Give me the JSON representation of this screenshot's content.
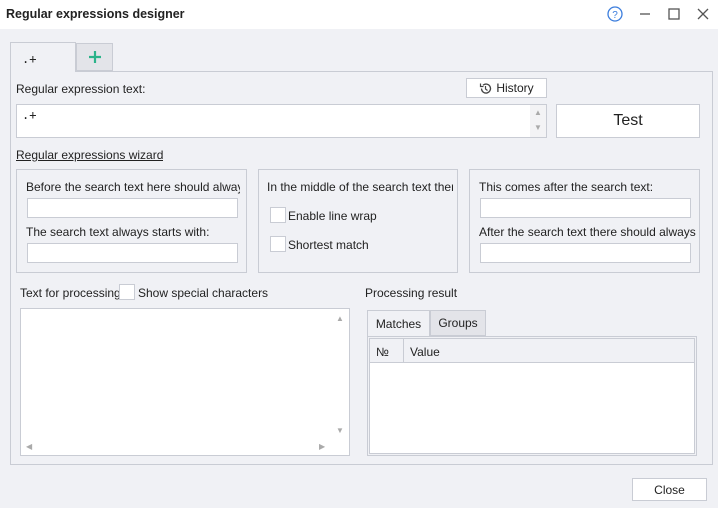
{
  "window": {
    "title": "Regular expressions designer"
  },
  "tabs": [
    {
      "label": ".+"
    },
    {
      "label": "+"
    }
  ],
  "regex": {
    "label": "Regular expression text:",
    "value": ".+",
    "history_label": "History",
    "test_label": "Test"
  },
  "wizard": {
    "link": "Regular expressions wizard",
    "before": {
      "label1": "Before the search text here should always b",
      "label2": "The search text always starts with:"
    },
    "middle": {
      "label": "In the middle of the search text there",
      "line_wrap": "Enable line wrap",
      "shortest": "Shortest match"
    },
    "after": {
      "label1": "This comes after the search text:",
      "label2": "After the search text there should always be"
    }
  },
  "processing": {
    "label": "Text for processing",
    "special_chars": "Show special characters",
    "value": ""
  },
  "result": {
    "label": "Processing result",
    "tabs": [
      "Matches",
      "Groups"
    ],
    "columns": [
      "№",
      "Value"
    ],
    "rows": []
  },
  "footer": {
    "close_label": "Close"
  },
  "colors": {
    "accent_plus": "#2bb38a",
    "help": "#3b7ddd"
  }
}
